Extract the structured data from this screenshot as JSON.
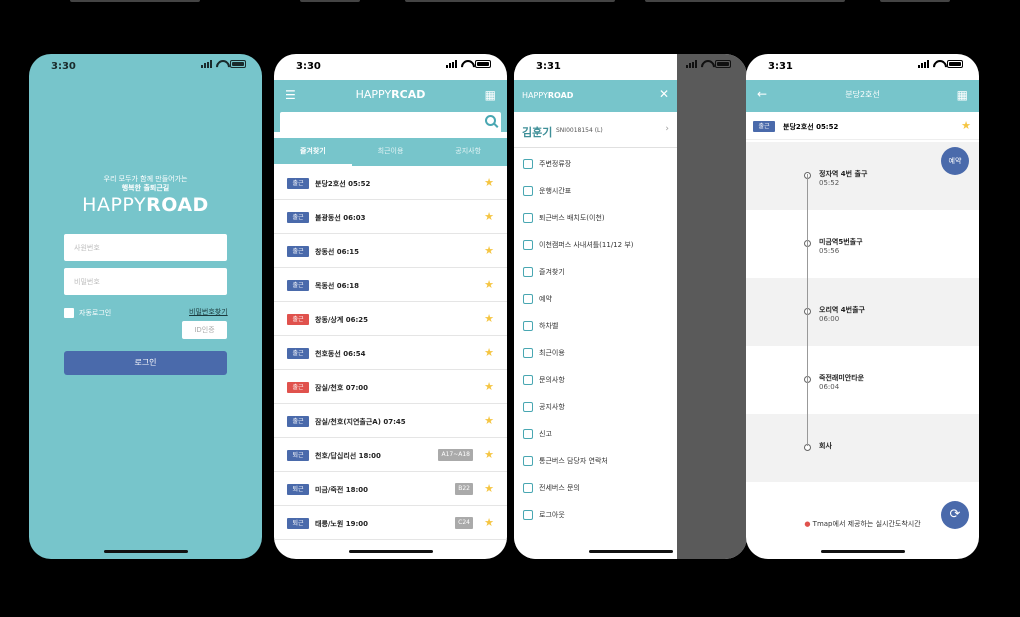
{
  "brand": {
    "happy": "HAPPY",
    "road": "ROAD",
    "road_alt": "RCAD"
  },
  "login": {
    "time": "3:30",
    "slogan_line1": "우리 모두가 함께 만들어가는",
    "slogan_line2": "행복한 출퇴근길",
    "employee_placeholder": "사원번호",
    "password_placeholder": "비밀번호",
    "auto_login": "자동로그인",
    "find_password": "비밀번호찾기",
    "id_auth": "ID인증",
    "login_button": "로그인"
  },
  "favorites": {
    "time": "3:30",
    "tabs": [
      "즐겨찾기",
      "최근이용",
      "공지사항"
    ],
    "rows": [
      {
        "badge": "출근",
        "color": "#4a6aab",
        "text": "분당2호선 05:52",
        "tag": ""
      },
      {
        "badge": "출근",
        "color": "#4a6aab",
        "text": "불광동선 06:03",
        "tag": ""
      },
      {
        "badge": "출근",
        "color": "#4a6aab",
        "text": "창동선 06:15",
        "tag": ""
      },
      {
        "badge": "출근",
        "color": "#4a6aab",
        "text": "목동선 06:18",
        "tag": ""
      },
      {
        "badge": "출근",
        "color": "#e0524d",
        "text": "창동/상계 06:25",
        "tag": ""
      },
      {
        "badge": "출근",
        "color": "#4a6aab",
        "text": "천호동선 06:54",
        "tag": ""
      },
      {
        "badge": "출근",
        "color": "#e0524d",
        "text": "잠실/천호 07:00",
        "tag": ""
      },
      {
        "badge": "출근",
        "color": "#4a6aab",
        "text": "잠실/천호(지연출근A) 07:45",
        "tag": ""
      },
      {
        "badge": "퇴근",
        "color": "#4a6aab",
        "text": "천호/답십리선 18:00",
        "tag": "A17~A18"
      },
      {
        "badge": "퇴근",
        "color": "#4a6aab",
        "text": "미금/죽전 18:00",
        "tag": "B22"
      },
      {
        "badge": "퇴근",
        "color": "#4a6aab",
        "text": "태릉/노원 19:00",
        "tag": "C24"
      }
    ]
  },
  "drawer": {
    "time": "3:31",
    "user_name": "김훈기",
    "user_id": "SNI0018154 (L)",
    "items": [
      "주변정류장",
      "운행시간표",
      "퇴근버스 배치도(이천)",
      "이천캠퍼스 사내셔틀(11/12 부)",
      "즐겨찾기",
      "예약",
      "하차벨",
      "최근이용",
      "문의사항",
      "공지사항",
      "신고",
      "통근버스 담당자 연락처",
      "전세버스 문의",
      "로그아웃"
    ]
  },
  "route": {
    "time": "3:31",
    "title": "분당2호선",
    "badge": "출근",
    "selected": "분당2호선 05:52",
    "reserve": "예약",
    "stops": [
      {
        "name": "정자역 4번 출구",
        "time": "05:52"
      },
      {
        "name": "미금역5번출구",
        "time": "05:56"
      },
      {
        "name": "오리역 4번출구",
        "time": "06:00"
      },
      {
        "name": "죽전래미안타운",
        "time": "06:04"
      },
      {
        "name": "회사",
        "time": ""
      }
    ],
    "footer": "Tmap에서 제공하는 실시간도착시간"
  }
}
